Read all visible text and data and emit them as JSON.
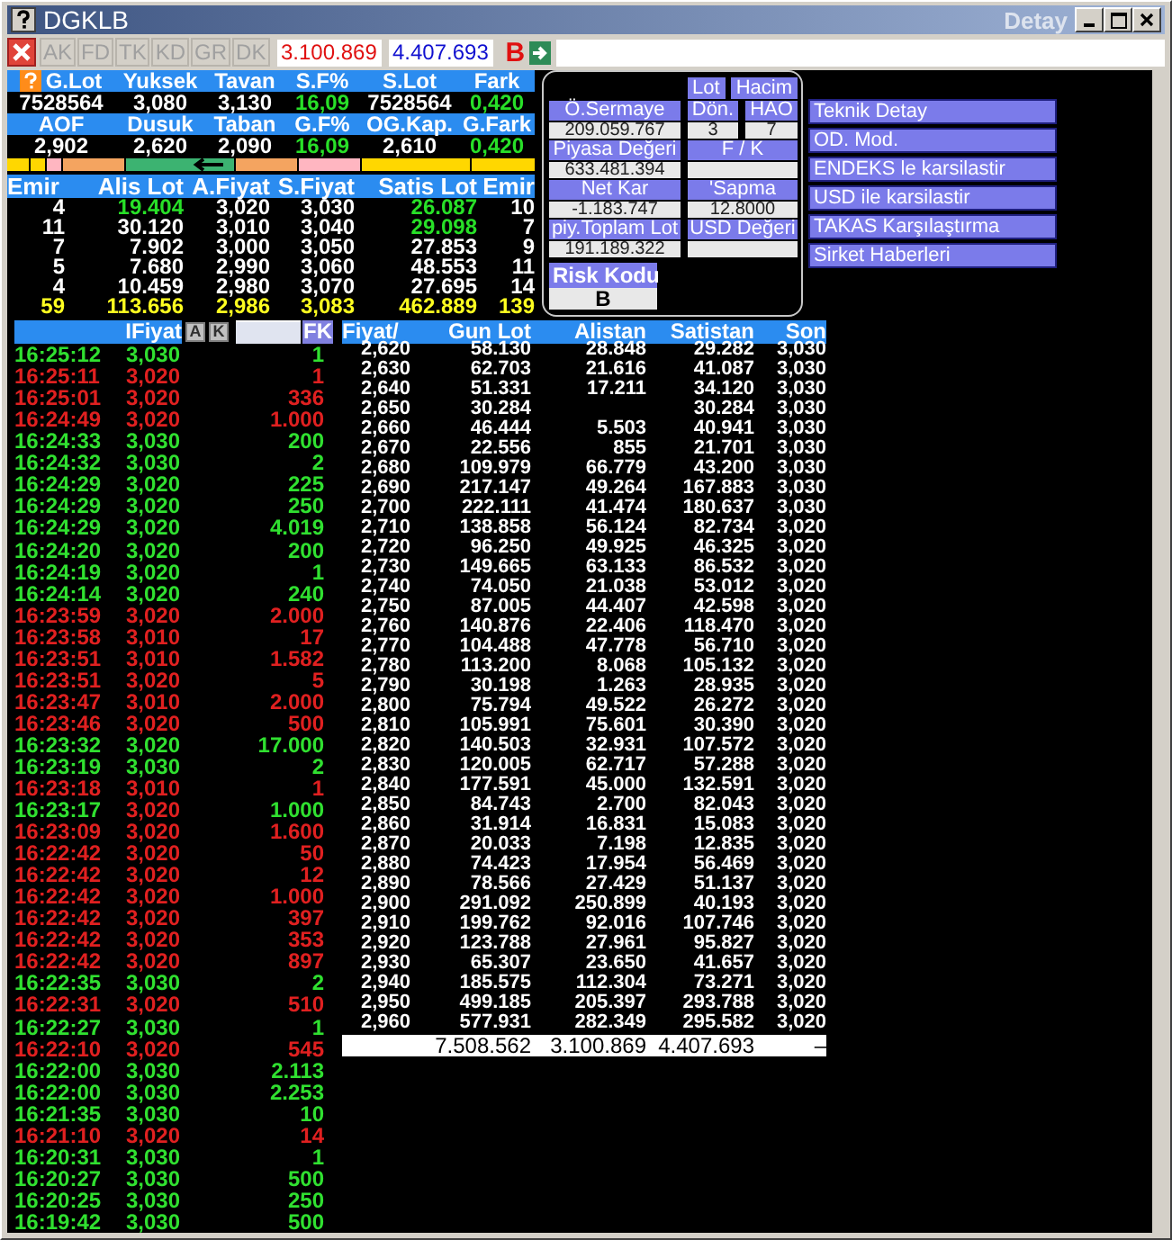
{
  "window": {
    "title": "DGKLB",
    "subtitle": "Detay"
  },
  "toolbar": {
    "tabs": [
      "AK",
      "FD",
      "TK",
      "KD",
      "GR",
      "DK"
    ],
    "bid_total": "3.100.869",
    "ask_total": "4.407.693",
    "letter": "B"
  },
  "summary": [
    [
      {
        "label": "G.Lot",
        "value": "7528564",
        "kind": "plain"
      },
      {
        "label": "Yuksek",
        "value": "3,080",
        "kind": "plain"
      },
      {
        "label": "Tavan",
        "value": "3,130",
        "kind": "plain"
      },
      {
        "label": "S.F%",
        "value": "16,09",
        "kind": "change"
      },
      {
        "label": "S.Lot",
        "value": "7528564",
        "kind": "plain"
      },
      {
        "label": "Fark",
        "value": "0,420",
        "kind": "change"
      }
    ],
    [
      {
        "label": "AOF",
        "value": "2,902",
        "kind": "plain"
      },
      {
        "label": "Dusuk",
        "value": "2,620",
        "kind": "plain"
      },
      {
        "label": "Taban",
        "value": "2,090",
        "kind": "plain"
      },
      {
        "label": "G.F%",
        "value": "16,09",
        "kind": "change"
      },
      {
        "label": "OG.Kap.",
        "value": "2,610",
        "kind": "plain"
      },
      {
        "label": "G.Fark",
        "value": "0,420",
        "kind": "change"
      }
    ]
  ],
  "depth_book": {
    "columns": [
      "Emir",
      "Alis Lot",
      "A.Fiyat",
      "S.Fiyat",
      "Satis Lot",
      "Emir"
    ],
    "rows": [
      {
        "cells": [
          "4",
          "19.404",
          "3,020",
          "3,030",
          "26.087",
          "10"
        ],
        "bid_new": true,
        "ask_new": true
      },
      {
        "cells": [
          "11",
          "30.120",
          "3,010",
          "3,040",
          "29.098",
          "7"
        ],
        "bid_new": false,
        "ask_new": true
      },
      {
        "cells": [
          "7",
          "7.902",
          "3,000",
          "3,050",
          "27.853",
          "9"
        ],
        "bid_new": false,
        "ask_new": false
      },
      {
        "cells": [
          "5",
          "7.680",
          "2,990",
          "3,060",
          "48.553",
          "11"
        ],
        "bid_new": false,
        "ask_new": false
      },
      {
        "cells": [
          "4",
          "10.459",
          "2,980",
          "3,070",
          "27.695",
          "14"
        ],
        "bid_new": false,
        "ask_new": false
      }
    ],
    "totals": [
      "59",
      "113.656",
      "2,986",
      "3,083",
      "462.889",
      "139"
    ]
  },
  "info_panel": {
    "buttons": [
      "Lot",
      "Hacim"
    ],
    "field_rows": [
      [
        {
          "label": "Ö.Sermaye",
          "value": "209.059.767"
        },
        {
          "label": "Dön.",
          "value": "3"
        },
        {
          "label": "HAO",
          "value": "7"
        }
      ],
      [
        {
          "label": "Piyasa Değeri",
          "value": "633.481.394"
        },
        {
          "label": "F / K"
        }
      ],
      [
        {
          "label": "Net Kar",
          "value": "-1.183.747"
        },
        {
          "label": "'Sapma",
          "value": "12.8000"
        }
      ],
      [
        {
          "label": "piy.Toplam Lot",
          "value": "191.189.322"
        },
        {
          "label": "USD Değeri"
        }
      ]
    ],
    "risk": {
      "label": "Risk Kodu",
      "value": "B"
    }
  },
  "links": [
    "Teknik Detay",
    "OD. Mod.",
    "ENDEKS le karsilastir",
    "USD ile karsilastir",
    "TAKAS Karşılaştırma",
    "Sirket Haberleri"
  ],
  "trades": {
    "header": "IFiyat",
    "buttons": [
      "A",
      "K"
    ],
    "filter_button": "FK",
    "rows": [
      {
        "time": "16:25:12",
        "price": "3,030",
        "lot": "1",
        "buy": true,
        "price_up": true
      },
      {
        "time": "16:25:11",
        "price": "3,020",
        "lot": "1",
        "buy": false,
        "price_up": false
      },
      {
        "time": "16:25:01",
        "price": "3,020",
        "lot": "336",
        "buy": false,
        "price_up": false
      },
      {
        "time": "16:24:49",
        "price": "3,020",
        "lot": "1.000",
        "buy": false,
        "price_up": false
      },
      {
        "time": "16:24:33",
        "price": "3,030",
        "lot": "200",
        "buy": true,
        "price_up": true
      },
      {
        "time": "16:24:32",
        "price": "3,030",
        "lot": "2",
        "buy": true,
        "price_up": true
      },
      {
        "time": "16:24:29",
        "price": "3,020",
        "lot": "225",
        "buy": true,
        "price_up": true
      },
      {
        "time": "16:24:29",
        "price": "3,020",
        "lot": "250",
        "buy": true,
        "price_up": true
      },
      {
        "time": "16:24:29",
        "price": "3,020",
        "lot": "4.019",
        "buy": true,
        "price_up": true
      },
      {
        "time": "16:24:20",
        "price": "3,020",
        "lot": "200",
        "buy": true,
        "price_up": true
      },
      {
        "time": "16:24:19",
        "price": "3,020",
        "lot": "1",
        "buy": true,
        "price_up": true
      },
      {
        "time": "16:24:14",
        "price": "3,020",
        "lot": "240",
        "buy": true,
        "price_up": true
      },
      {
        "time": "16:23:59",
        "price": "3,020",
        "lot": "2.000",
        "buy": false,
        "price_up": false
      },
      {
        "time": "16:23:58",
        "price": "3,010",
        "lot": "17",
        "buy": false,
        "price_up": false
      },
      {
        "time": "16:23:51",
        "price": "3,010",
        "lot": "1.582",
        "buy": false,
        "price_up": false
      },
      {
        "time": "16:23:51",
        "price": "3,020",
        "lot": "5",
        "buy": false,
        "price_up": false
      },
      {
        "time": "16:23:47",
        "price": "3,010",
        "lot": "2.000",
        "buy": false,
        "price_up": false
      },
      {
        "time": "16:23:46",
        "price": "3,020",
        "lot": "500",
        "buy": false,
        "price_up": false
      },
      {
        "time": "16:23:32",
        "price": "3,020",
        "lot": "17.000",
        "buy": true,
        "price_up": true
      },
      {
        "time": "16:23:19",
        "price": "3,030",
        "lot": "2",
        "buy": true,
        "price_up": true
      },
      {
        "time": "16:23:18",
        "price": "3,010",
        "lot": "1",
        "buy": false,
        "price_up": false
      },
      {
        "time": "16:23:17",
        "price": "3,020",
        "lot": "1.000",
        "buy": true,
        "price_up": false
      },
      {
        "time": "16:23:09",
        "price": "3,020",
        "lot": "1.600",
        "buy": false,
        "price_up": false
      },
      {
        "time": "16:22:42",
        "price": "3,020",
        "lot": "50",
        "buy": false,
        "price_up": false
      },
      {
        "time": "16:22:42",
        "price": "3,020",
        "lot": "12",
        "buy": false,
        "price_up": false
      },
      {
        "time": "16:22:42",
        "price": "3,020",
        "lot": "1.000",
        "buy": false,
        "price_up": false
      },
      {
        "time": "16:22:42",
        "price": "3,020",
        "lot": "397",
        "buy": false,
        "price_up": false
      },
      {
        "time": "16:22:42",
        "price": "3,020",
        "lot": "353",
        "buy": false,
        "price_up": false
      },
      {
        "time": "16:22:42",
        "price": "3,020",
        "lot": "897",
        "buy": false,
        "price_up": false
      },
      {
        "time": "16:22:35",
        "price": "3,030",
        "lot": "2",
        "buy": true,
        "price_up": true
      },
      {
        "time": "16:22:31",
        "price": "3,020",
        "lot": "510",
        "buy": false,
        "price_up": false
      },
      {
        "time": "16:22:27",
        "price": "3,030",
        "lot": "1",
        "buy": true,
        "price_up": true
      },
      {
        "time": "16:22:10",
        "price": "3,020",
        "lot": "545",
        "buy": false,
        "price_up": false
      },
      {
        "time": "16:22:00",
        "price": "3,030",
        "lot": "2.113",
        "buy": true,
        "price_up": true
      },
      {
        "time": "16:22:00",
        "price": "3,030",
        "lot": "2.253",
        "buy": true,
        "price_up": true
      },
      {
        "time": "16:21:35",
        "price": "3,030",
        "lot": "10",
        "buy": true,
        "price_up": true
      },
      {
        "time": "16:21:10",
        "price": "3,020",
        "lot": "14",
        "buy": false,
        "price_up": false
      },
      {
        "time": "16:20:31",
        "price": "3,030",
        "lot": "1",
        "buy": true,
        "price_up": true
      },
      {
        "time": "16:20:27",
        "price": "3,030",
        "lot": "500",
        "buy": true,
        "price_up": true
      },
      {
        "time": "16:20:25",
        "price": "3,030",
        "lot": "250",
        "buy": true,
        "price_up": true
      },
      {
        "time": "16:19:42",
        "price": "3,030",
        "lot": "500",
        "buy": true,
        "price_up": true
      }
    ]
  },
  "price_table": {
    "columns": [
      "Fiyat/",
      "Gun Lot",
      "Alistan",
      "Satistan",
      "Son"
    ],
    "rows": [
      [
        "2,620",
        "58.130",
        "28.848",
        "29.282",
        "3,030"
      ],
      [
        "2,630",
        "62.703",
        "21.616",
        "41.087",
        "3,030"
      ],
      [
        "2,640",
        "51.331",
        "17.211",
        "34.120",
        "3,030"
      ],
      [
        "2,650",
        "30.284",
        null,
        "30.284",
        "3,030"
      ],
      [
        "2,660",
        "46.444",
        "5.503",
        "40.941",
        "3,030"
      ],
      [
        "2,670",
        "22.556",
        "855",
        "21.701",
        "3,030"
      ],
      [
        "2,680",
        "109.979",
        "66.779",
        "43.200",
        "3,030"
      ],
      [
        "2,690",
        "217.147",
        "49.264",
        "167.883",
        "3,030"
      ],
      [
        "2,700",
        "222.111",
        "41.474",
        "180.637",
        "3,030"
      ],
      [
        "2,710",
        "138.858",
        "56.124",
        "82.734",
        "3,020"
      ],
      [
        "2,720",
        "96.250",
        "49.925",
        "46.325",
        "3,020"
      ],
      [
        "2,730",
        "149.665",
        "63.133",
        "86.532",
        "3,020"
      ],
      [
        "2,740",
        "74.050",
        "21.038",
        "53.012",
        "3,020"
      ],
      [
        "2,750",
        "87.005",
        "44.407",
        "42.598",
        "3,020"
      ],
      [
        "2,760",
        "140.876",
        "22.406",
        "118.470",
        "3,020"
      ],
      [
        "2,770",
        "104.488",
        "47.778",
        "56.710",
        "3,020"
      ],
      [
        "2,780",
        "113.200",
        "8.068",
        "105.132",
        "3,020"
      ],
      [
        "2,790",
        "30.198",
        "1.263",
        "28.935",
        "3,020"
      ],
      [
        "2,800",
        "75.794",
        "49.522",
        "26.272",
        "3,020"
      ],
      [
        "2,810",
        "105.991",
        "75.601",
        "30.390",
        "3,020"
      ],
      [
        "2,820",
        "140.503",
        "32.931",
        "107.572",
        "3,020"
      ],
      [
        "2,830",
        "120.005",
        "62.717",
        "57.288",
        "3,020"
      ],
      [
        "2,840",
        "177.591",
        "45.000",
        "132.591",
        "3,020"
      ],
      [
        "2,850",
        "84.743",
        "2.700",
        "82.043",
        "3,020"
      ],
      [
        "2,860",
        "31.914",
        "16.831",
        "15.083",
        "3,020"
      ],
      [
        "2,870",
        "20.033",
        "7.198",
        "12.835",
        "3,020"
      ],
      [
        "2,880",
        "74.423",
        "17.954",
        "56.469",
        "3,020"
      ],
      [
        "2,890",
        "78.566",
        "27.429",
        "51.137",
        "3,020"
      ],
      [
        "2,900",
        "291.092",
        "250.899",
        "40.193",
        "3,020"
      ],
      [
        "2,910",
        "199.762",
        "92.016",
        "107.746",
        "3,020"
      ],
      [
        "2,920",
        "123.788",
        "27.961",
        "95.827",
        "3,020"
      ],
      [
        "2,930",
        "65.307",
        "23.650",
        "41.657",
        "3,020"
      ],
      [
        "2,940",
        "185.575",
        "112.304",
        "73.271",
        "3,020"
      ],
      [
        "2,950",
        "499.185",
        "205.397",
        "293.788",
        "3,020"
      ],
      [
        "2,960",
        "577.931",
        "282.349",
        "295.582",
        "3,020"
      ]
    ],
    "totals": {
      "volume": "7.508.562",
      "bid": "3.100.869",
      "ask": "4.407.693",
      "last": "–"
    }
  }
}
